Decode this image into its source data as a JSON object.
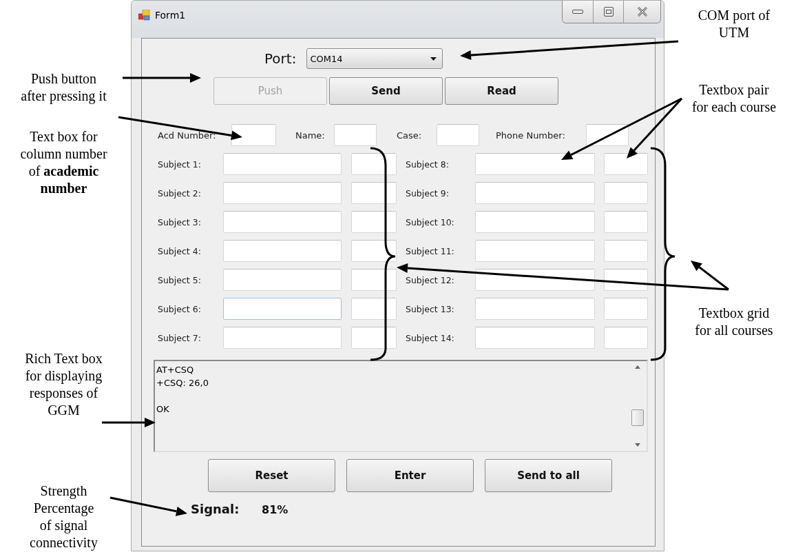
{
  "window": {
    "title": "Form1"
  },
  "port": {
    "label": "Port:",
    "value": "COM14"
  },
  "top_buttons": [
    {
      "label": "Push",
      "disabled": true
    },
    {
      "label": "Send",
      "disabled": false
    },
    {
      "label": "Read",
      "disabled": false
    }
  ],
  "info_fields": [
    {
      "label": "Acd Number:"
    },
    {
      "label": "Name:"
    },
    {
      "label": "Case:"
    },
    {
      "label": "Phone Number:"
    }
  ],
  "subjects_left": [
    {
      "label": "Subject 1:",
      "focused": false
    },
    {
      "label": "Subject 2:",
      "focused": false
    },
    {
      "label": "Subject 3:",
      "focused": false
    },
    {
      "label": "Subject 4:",
      "focused": false
    },
    {
      "label": "Subject 5:",
      "focused": false
    },
    {
      "label": "Subject 6:",
      "focused": true
    },
    {
      "label": "Subject 7:",
      "focused": false
    }
  ],
  "subjects_right": [
    {
      "label": "Subject 8:",
      "focused": false
    },
    {
      "label": "Subject 9:",
      "focused": false
    },
    {
      "label": "Subject 10:",
      "focused": false
    },
    {
      "label": "Subject 11:",
      "focused": false
    },
    {
      "label": "Subject 12:",
      "focused": false
    },
    {
      "label": "Subject 13:",
      "focused": false
    },
    {
      "label": "Subject 14:",
      "focused": false
    }
  ],
  "response_log": {
    "text": "AT+CSQ\n+CSQ: 26,0\n\nOK"
  },
  "bottom_buttons": [
    {
      "label": "Reset"
    },
    {
      "label": "Enter"
    },
    {
      "label": "Send to all"
    }
  ],
  "signal": {
    "label": "Signal:",
    "value": "81%"
  },
  "annotations_left": [
    {
      "lines": [
        "Push button",
        "after pressing it"
      ]
    },
    {
      "lines": [
        "Text box for",
        "column number",
        "of **academic**",
        "**number**"
      ]
    },
    {
      "lines": [
        "Rich Text box",
        "for displaying",
        "responses of",
        "GGM"
      ]
    },
    {
      "lines": [
        "Strength",
        "Percentage",
        "of signal",
        "connectivity"
      ]
    }
  ],
  "annotations_right": [
    {
      "lines": [
        "COM port of",
        "UTM"
      ]
    },
    {
      "lines": [
        "Textbox  pair",
        "for each course"
      ]
    },
    {
      "lines": [
        "Textbox grid",
        "for all courses"
      ]
    }
  ]
}
